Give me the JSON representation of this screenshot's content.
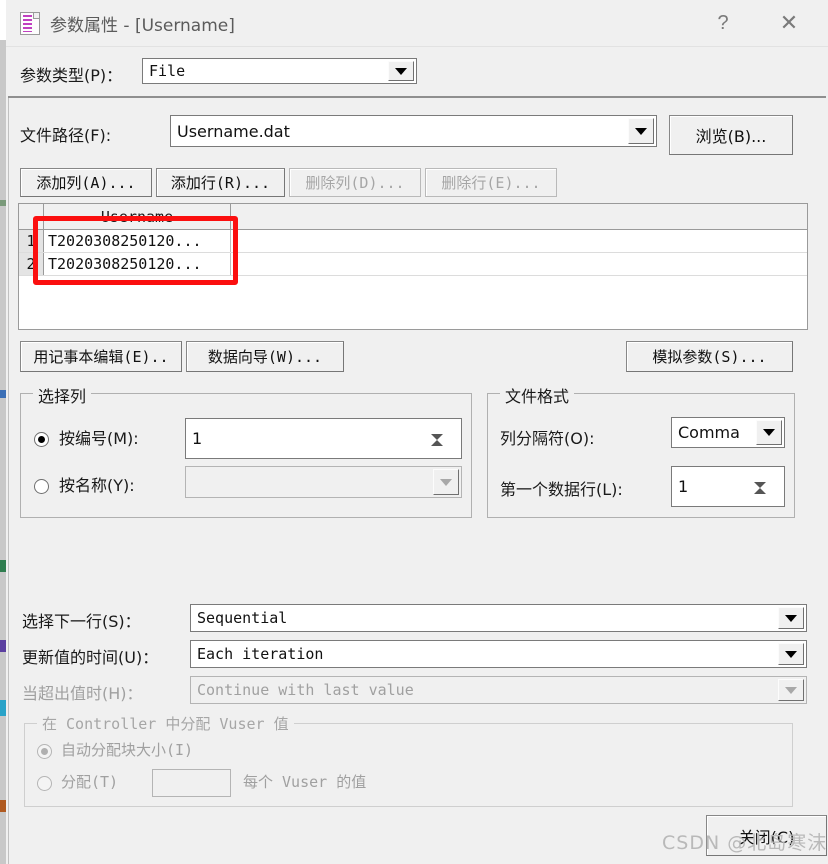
{
  "window": {
    "title": "参数属性 - [Username]",
    "icon": "parameter-properties-icon",
    "help_label": "?",
    "close_label": "✕"
  },
  "param_type": {
    "label": "参数类型(P)：",
    "value": "File"
  },
  "file_path": {
    "label": "文件路径(F):",
    "value": "Username.dat",
    "browse_label": "浏览(B)..."
  },
  "grid_toolbar": {
    "add_column": "添加列(A)...",
    "add_row": "添加行(R)...",
    "delete_column": "删除列(D)...",
    "delete_row": "删除行(E)..."
  },
  "grid": {
    "columns": [
      "Username"
    ],
    "rows": [
      {
        "index": "1",
        "Username": "T2020308250120..."
      },
      {
        "index": "2",
        "Username": "T2020308250120..."
      }
    ]
  },
  "data_buttons": {
    "edit_with_notepad": "用记事本编辑(E)..",
    "data_wizard": "数据向导(W)...",
    "simulate_parameter": "模拟参数(S)..."
  },
  "select_column": {
    "group_title": "选择列",
    "by_number_label": "按编号(M):",
    "by_number_selected": true,
    "by_number_value": "1",
    "by_name_label": "按名称(Y):",
    "by_name_selected": false,
    "by_name_value": ""
  },
  "file_format": {
    "group_title": "文件格式",
    "column_delimiter_label": "列分隔符(O):",
    "column_delimiter_value": "Comma",
    "first_data_row_label": "第一个数据行(L):",
    "first_data_row_value": "1"
  },
  "value_options": {
    "select_next_row_label": "选择下一行(S)：",
    "select_next_row_value": "Sequential",
    "update_value_on_label": "更新值的时间(U)：",
    "update_value_on_value": "Each iteration",
    "when_out_of_values_label": "当超出值时(H)：",
    "when_out_of_values_value": "Continue with last value"
  },
  "allocate_group": {
    "group_title": "在 Controller 中分配 Vuser 值",
    "auto_allocate_label": "自动分配块大小(I)",
    "auto_allocate_selected": true,
    "allocate_label": "分配(T)",
    "allocate_value": "",
    "allocate_suffix": "每个 Vuser 的值"
  },
  "footer": {
    "close_button": "关闭(C)"
  },
  "watermark": {
    "text": "CSDN @北岛寒沫"
  },
  "colors": {
    "dialog_bg": "#f0f0f0",
    "field_bg": "#ffffff",
    "annotation_red": "#fb0f0f",
    "disabled_text": "#a6a6a6",
    "title_text": "#5b5b5b"
  }
}
